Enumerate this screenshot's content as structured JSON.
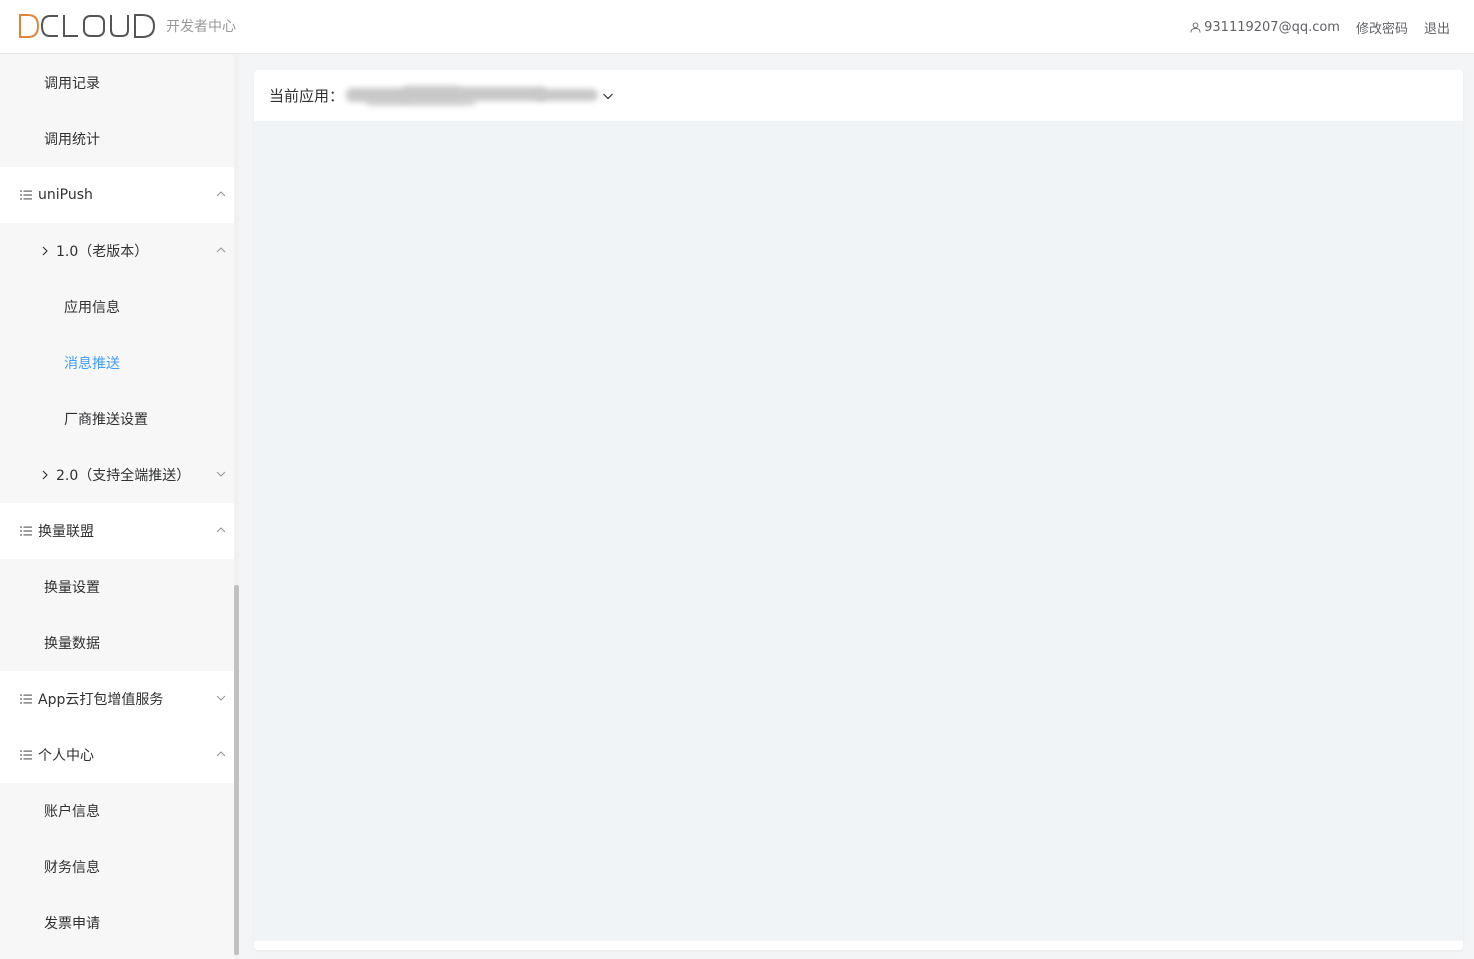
{
  "header": {
    "logo_text": "DCLOUD",
    "logo_subtitle": "开发者中心",
    "user_email": "931119207@qq.com",
    "change_password": "修改密码",
    "logout": "退出",
    "brand_color": "#e0843a"
  },
  "sidebar": {
    "items": [
      {
        "label": "调用记录",
        "type": "sub"
      },
      {
        "label": "调用统计",
        "type": "sub"
      },
      {
        "label": "uniPush",
        "type": "group",
        "expanded": true
      },
      {
        "label": "1.0（老版本）",
        "type": "subgroup",
        "expanded": true
      },
      {
        "label": "应用信息",
        "type": "leaf"
      },
      {
        "label": "消息推送",
        "type": "leaf",
        "active": true
      },
      {
        "label": "厂商推送设置",
        "type": "leaf"
      },
      {
        "label": "2.0（支持全端推送）",
        "type": "subgroup",
        "expanded": false
      },
      {
        "label": "换量联盟",
        "type": "group",
        "expanded": true
      },
      {
        "label": "换量设置",
        "type": "sub"
      },
      {
        "label": "换量数据",
        "type": "sub"
      },
      {
        "label": "App云打包增值服务",
        "type": "group",
        "expanded": false
      },
      {
        "label": "个人中心",
        "type": "group",
        "expanded": true
      },
      {
        "label": "账户信息",
        "type": "sub"
      },
      {
        "label": "财务信息",
        "type": "sub"
      },
      {
        "label": "发票申请",
        "type": "sub"
      }
    ],
    "active_color": "#409eff"
  },
  "main": {
    "current_app_label": "当前应用："
  }
}
